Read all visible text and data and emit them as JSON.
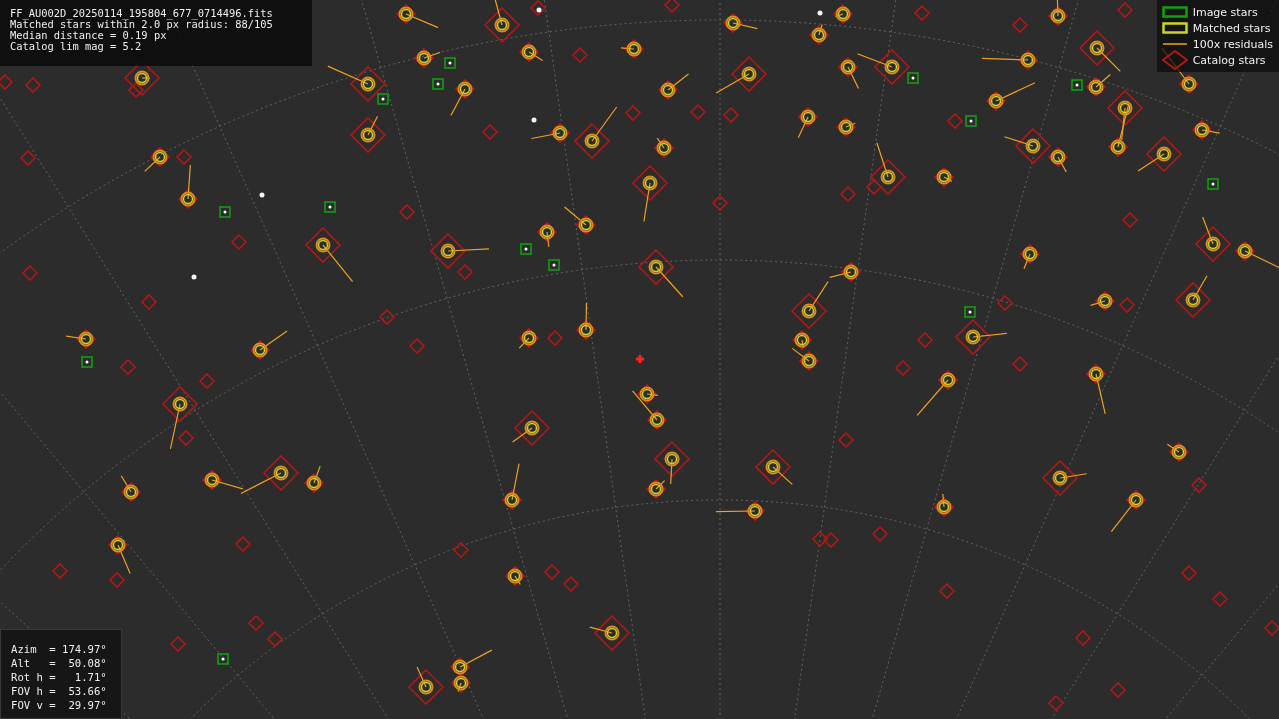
{
  "info": {
    "lines": [
      "FF_AU002D_20250114_195804_677_0714496.fits",
      "Matched stars within 2.0 px radius: 88/105",
      "Median distance = 0.19 px",
      "Catalog lim mag = 5.2"
    ]
  },
  "legend": [
    {
      "kind": "image",
      "label": "Image stars"
    },
    {
      "kind": "matched",
      "label": "Matched stars"
    },
    {
      "kind": "residual",
      "label": "100x residuals"
    },
    {
      "kind": "catalog",
      "label": "Catalog stars"
    }
  ],
  "pointing": {
    "lines": [
      "Azim  = 174.97°",
      "Alt   =  50.08°",
      "Rot h =   1.71°",
      "FOV h =  53.66°",
      "FOV v =  29.97°"
    ]
  }
}
